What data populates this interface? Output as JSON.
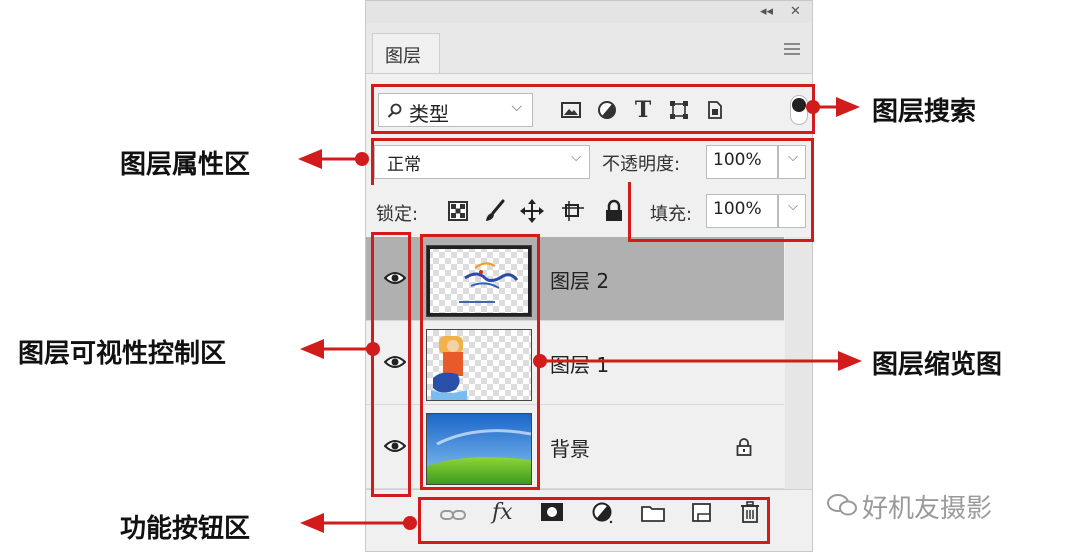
{
  "panel": {
    "tab_label": "图层",
    "topbar_collapse": "◂◂",
    "topbar_close": "✕"
  },
  "filter": {
    "kind_label": "类型",
    "icons": [
      "image-filter-icon",
      "adjustment-filter-icon",
      "type-filter-icon",
      "shape-filter-icon",
      "smart-object-filter-icon"
    ],
    "text_filter_glyph": "T"
  },
  "blend": {
    "mode": "正常",
    "opacity_label": "不透明度:",
    "opacity_value": "100%"
  },
  "lock": {
    "label": "锁定:",
    "fill_label": "填充:",
    "fill_value": "100%"
  },
  "layers": [
    {
      "name": "图层 2",
      "selected": true
    },
    {
      "name": "图层 1",
      "selected": false
    },
    {
      "name": "背景",
      "selected": false,
      "locked": true
    }
  ],
  "bottom_buttons": {
    "fx": "fx"
  },
  "callouts": {
    "search": "图层搜索",
    "properties": "图层属性区",
    "visibility": "图层可视性控制区",
    "thumbnail": "图层缩览图",
    "buttons": "功能按钮区"
  },
  "watermark": "好机友摄影",
  "colors": {
    "annotation_red": "#d21c1c",
    "selected_layer": "#b0b0b0",
    "panel_bg": "#f0f0f0"
  }
}
